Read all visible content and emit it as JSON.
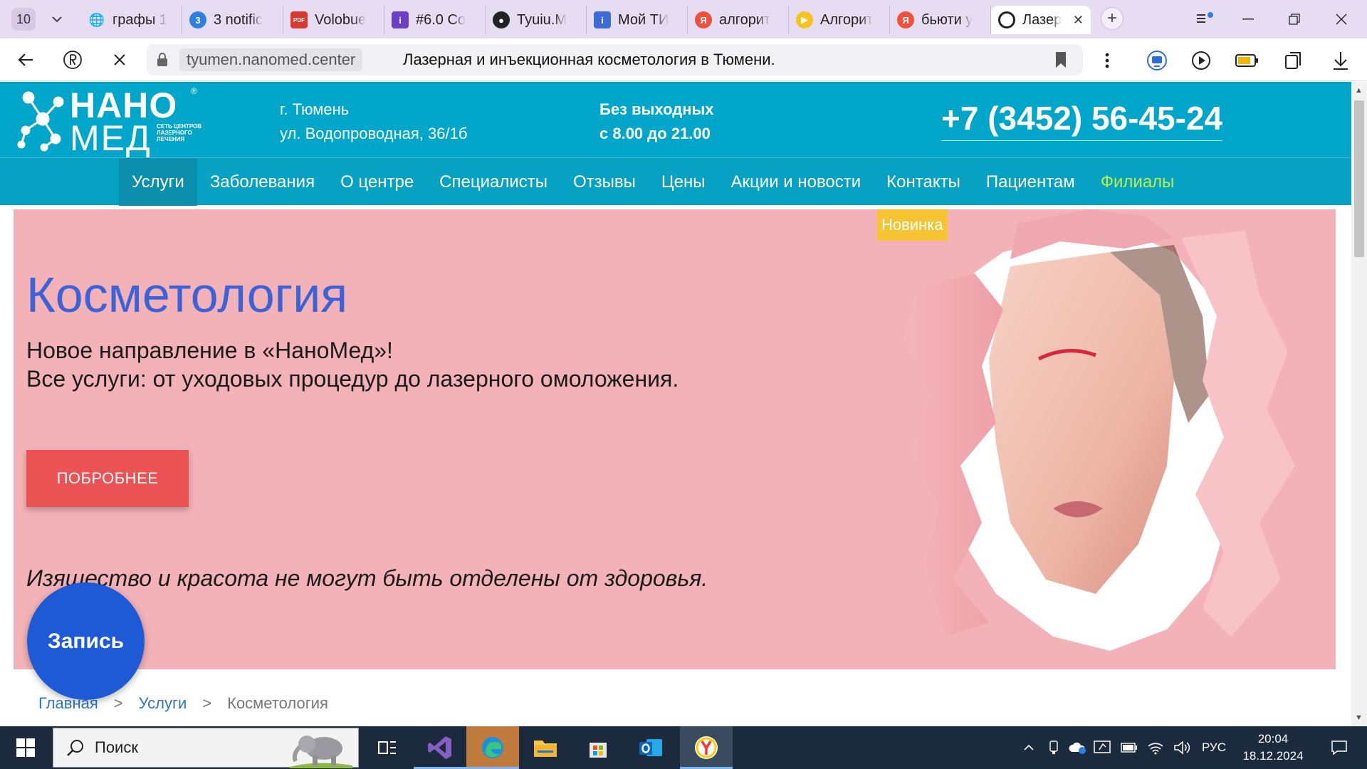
{
  "browser": {
    "tab_count": "10",
    "tabs": [
      {
        "label": "графы 1",
        "icon": "globe-icon",
        "color": "#2f6fd1"
      },
      {
        "label": "3 notific",
        "icon": "notification-badge-icon",
        "color": "#2d7fe0",
        "badge": "3"
      },
      {
        "label": "Volobue",
        "icon": "pdf-icon",
        "color": "#d63a2f",
        "badge": "PDF"
      },
      {
        "label": "#6.0 Co",
        "icon": "info-square-icon",
        "color": "#6b3fc4",
        "badge": "i"
      },
      {
        "label": "Tyuiu.M",
        "icon": "github-icon",
        "color": "#222222"
      },
      {
        "label": "Мой ТИ",
        "icon": "info-square-icon",
        "color": "#3d6bd6",
        "badge": "i"
      },
      {
        "label": "алгорит",
        "icon": "yandex-icon",
        "color": "#f0503c",
        "badge": "Я"
      },
      {
        "label": "Алгорит",
        "icon": "play-icon",
        "color": "#f7c21c",
        "badge": "▶"
      },
      {
        "label": "бьюти у",
        "icon": "yandex-icon",
        "color": "#f0503c",
        "badge": "Я"
      },
      {
        "label": "Лазер",
        "icon": "loading-icon",
        "color": "#222222",
        "active": true
      }
    ],
    "domain": "tyumen.nanomed.center",
    "page_title": "Лазерная и инъекционная косметология в Тюмени."
  },
  "site": {
    "logo_top": "НАНО",
    "logo_bottom": "МЕД",
    "logo_tagline": "СЕТЬ ЦЕНТРОВ ЛАЗЕРНОГО ЛЕЧЕНИЯ",
    "address_line1": "г. Тюмень",
    "address_line2": "ул. Водопроводная, 36/1б",
    "hours_line1": "Без выходных",
    "hours_line2": "с 8.00 до 21.00",
    "phone": "+7 (3452) 56-45-24",
    "nav": [
      "Услуги",
      "Заболевания",
      "О центре",
      "Специалисты",
      "Отзывы",
      "Цены",
      "Акции и новости",
      "Контакты",
      "Пациентам",
      "Филиалы"
    ],
    "hero": {
      "badge": "Новинка",
      "title": "Косметология",
      "subtitle_line1": "Новое направление в «НаноМед»!",
      "subtitle_line2": "Все услуги: от уходовых процедур до лазерного омоложения.",
      "button": "ПОБРОБНЕЕ",
      "quote": "Изящество и красота не могут быть отделены от здоровья."
    },
    "record_button": "Запись",
    "breadcrumb": [
      "Главная",
      "Услуги",
      "Косметология"
    ],
    "breadcrumb_sep": ">"
  },
  "colors": {
    "header_bg": "#00a6c9",
    "hero_bg": "#f3b2b7",
    "title_blue": "#3b63d7",
    "button_red": "#ea5253",
    "badge_yellow": "#f6c332",
    "record_blue": "#1e5ad6",
    "nav_highlight": "#b9f14a"
  },
  "taskbar": {
    "search_placeholder": "Поиск",
    "language": "РУС",
    "time": "20:04",
    "date": "18.12.2024"
  }
}
